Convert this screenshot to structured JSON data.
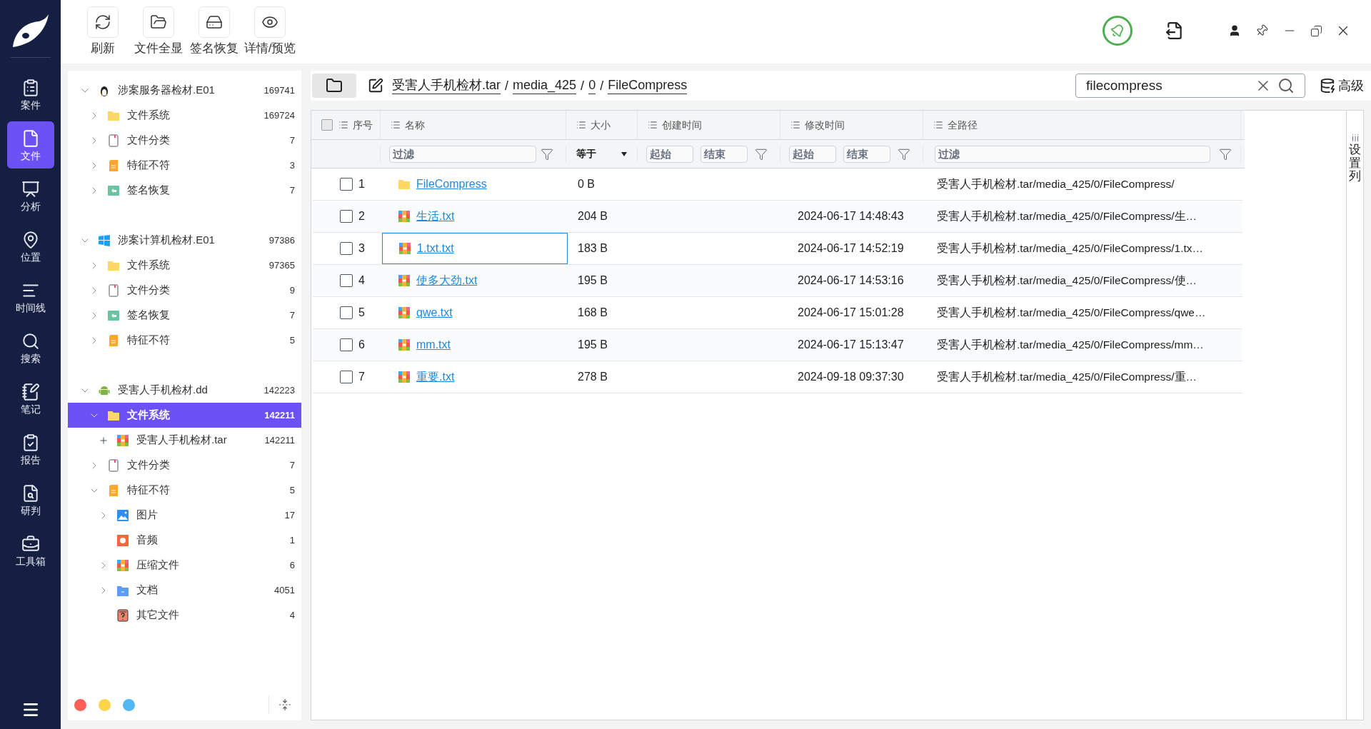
{
  "nav": [
    {
      "label": "案件",
      "selected": false
    },
    {
      "label": "文件",
      "selected": true
    },
    {
      "label": "分析",
      "selected": false
    },
    {
      "label": "位置",
      "selected": false
    },
    {
      "label": "时间线",
      "selected": false
    },
    {
      "label": "搜索",
      "selected": false
    },
    {
      "label": "笔记",
      "selected": false
    },
    {
      "label": "报告",
      "selected": false
    },
    {
      "label": "研判",
      "selected": false
    },
    {
      "label": "工具箱",
      "selected": false
    }
  ],
  "toolbar": [
    {
      "label": "刷新"
    },
    {
      "label": "文件全显"
    },
    {
      "label": "签名恢复"
    },
    {
      "label": "详情/预览"
    }
  ],
  "tree": [
    {
      "label": "涉案服务器检材.E01",
      "count": "169741",
      "kind": "linux",
      "expanded": true,
      "selected": false,
      "children": [
        {
          "label": "文件系统",
          "count": "169724",
          "kind": "folder",
          "expanded": false,
          "selected": false
        },
        {
          "label": "文件分类",
          "count": "7",
          "kind": "page",
          "expanded": false,
          "selected": false
        },
        {
          "label": "特征不符",
          "count": "3",
          "kind": "orange",
          "expanded": false,
          "selected": false
        },
        {
          "label": "签名恢复",
          "count": "7",
          "kind": "recover",
          "expanded": false,
          "selected": false
        }
      ]
    },
    {
      "label": "涉案计算机检材.E01",
      "count": "97386",
      "kind": "windows",
      "expanded": true,
      "selected": false,
      "children": [
        {
          "label": "文件系统",
          "count": "97365",
          "kind": "folder",
          "expanded": false,
          "selected": false
        },
        {
          "label": "文件分类",
          "count": "9",
          "kind": "page",
          "expanded": false,
          "selected": false
        },
        {
          "label": "签名恢复",
          "count": "7",
          "kind": "recover",
          "expanded": false,
          "selected": false
        },
        {
          "label": "特征不符",
          "count": "5",
          "kind": "orange",
          "expanded": false,
          "selected": false
        }
      ]
    },
    {
      "label": "受害人手机检材.dd",
      "count": "142223",
      "kind": "android",
      "expanded": true,
      "selected": false,
      "children": [
        {
          "label": "文件系统",
          "count": "142211",
          "kind": "folder",
          "expanded": true,
          "selected": true,
          "children": [
            {
              "label": "受害人手机检材.tar",
              "count": "142211",
              "kind": "archive",
              "plus": true,
              "selected": false
            }
          ]
        },
        {
          "label": "文件分类",
          "count": "7",
          "kind": "page",
          "expanded": false,
          "selected": false
        },
        {
          "label": "特征不符",
          "count": "5",
          "kind": "orange",
          "expanded": true,
          "selected": false,
          "children": [
            {
              "label": "图片",
              "count": "17",
              "kind": "image",
              "expanded": false,
              "selected": false
            },
            {
              "label": "音频",
              "count": "1",
              "kind": "audio",
              "selected": false
            },
            {
              "label": "压缩文件",
              "count": "6",
              "kind": "archive",
              "expanded": false,
              "selected": false
            },
            {
              "label": "文档",
              "count": "4051",
              "kind": "docs",
              "expanded": false,
              "selected": false
            },
            {
              "label": "其它文件",
              "count": "4",
              "kind": "other",
              "selected": false
            }
          ]
        }
      ]
    }
  ],
  "theme_dots": [
    {
      "color": "#fb5f57"
    },
    {
      "color": "#fdd54a"
    },
    {
      "color": "#50b8f5"
    }
  ],
  "breadcrumb": [
    {
      "label": "受害人手机检材.tar"
    },
    {
      "separator": "/",
      "label": "media_425"
    },
    {
      "separator": "/",
      "label": "0"
    },
    {
      "separator": "/",
      "label": "FileCompress"
    }
  ],
  "search": {
    "value": "filecompress"
  },
  "advanced": "高级",
  "table": {
    "header_checked": false,
    "columns": [
      {
        "label": "序号"
      },
      {
        "label": "名称"
      },
      {
        "label": "大小"
      },
      {
        "label": "创建时间"
      },
      {
        "label": "修改时间"
      },
      {
        "label": "全路径"
      }
    ],
    "filters": {
      "name": {
        "placeholder": "过滤"
      },
      "size": "等于",
      "created": {
        "start": {
          "placeholder": "起始"
        },
        "end": {
          "placeholder": "结束"
        }
      },
      "modified": {
        "start": {
          "placeholder": "起始"
        },
        "end": {
          "placeholder": "结束"
        }
      },
      "path": {
        "placeholder": "过滤"
      }
    },
    "rows": [
      {
        "checked": false,
        "seq": "1",
        "kind": "folder",
        "name": "FileCompress",
        "focused": false,
        "size": "0 B",
        "path": "受害人手机检材.tar/media_425/0/FileCompress/"
      },
      {
        "checked": false,
        "seq": "2",
        "kind": "archive",
        "name": "生活.txt",
        "focused": false,
        "size": "204 B",
        "modified": "2024-06-17 14:48:43",
        "path": "受害人手机检材.tar/media_425/0/FileCompress/生…"
      },
      {
        "checked": false,
        "seq": "3",
        "kind": "archive",
        "name": "1.txt.txt",
        "focused": true,
        "size": "183 B",
        "modified": "2024-06-17 14:52:19",
        "path": "受害人手机检材.tar/media_425/0/FileCompress/1.tx…"
      },
      {
        "checked": false,
        "seq": "4",
        "kind": "archive",
        "name": "使多大劲.txt",
        "focused": false,
        "size": "195 B",
        "modified": "2024-06-17 14:53:16",
        "path": "受害人手机检材.tar/media_425/0/FileCompress/使…"
      },
      {
        "checked": false,
        "seq": "5",
        "kind": "archive",
        "name": "qwe.txt",
        "focused": false,
        "size": "168 B",
        "modified": "2024-06-17 15:01:28",
        "path": "受害人手机检材.tar/media_425/0/FileCompress/qwe…"
      },
      {
        "checked": false,
        "seq": "6",
        "kind": "archive",
        "name": "mm.txt",
        "focused": false,
        "size": "195 B",
        "modified": "2024-06-17 15:13:47",
        "path": "受害人手机检材.tar/media_425/0/FileCompress/mm…"
      },
      {
        "checked": false,
        "seq": "7",
        "kind": "archive",
        "name": "重要.txt",
        "focused": false,
        "size": "278 B",
        "modified": "2024-09-18 09:37:30",
        "path": "受害人手机检材.tar/media_425/0/FileCompress/重…"
      }
    ]
  },
  "column_settings": "设置列"
}
